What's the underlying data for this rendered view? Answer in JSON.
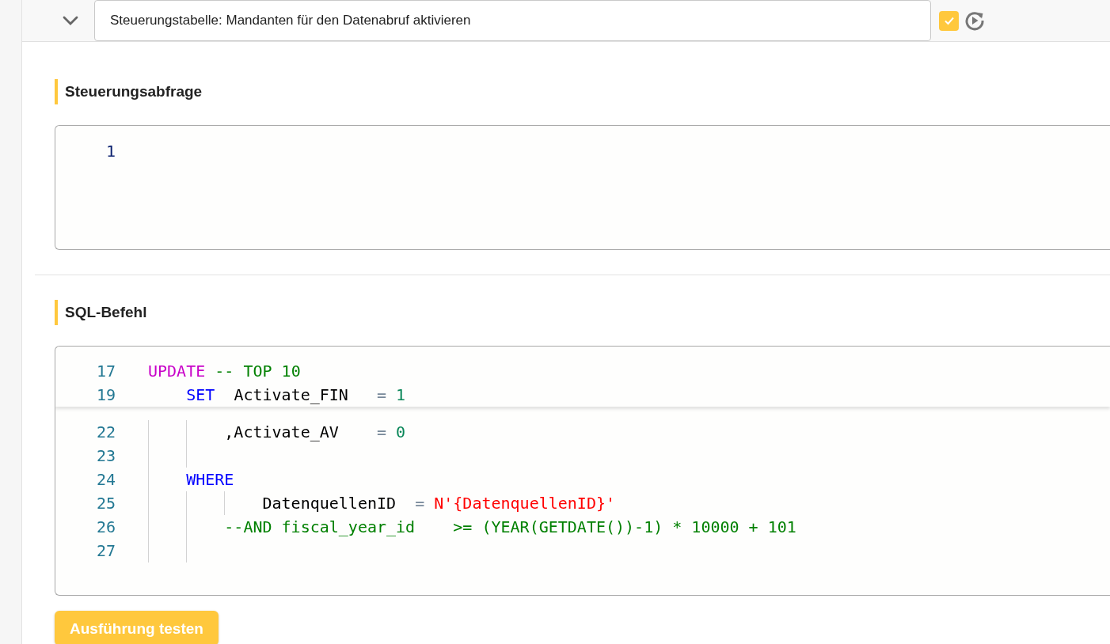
{
  "header": {
    "expanded": true,
    "title_value": "Steuerungstabelle: Mandanten für den Datenabruf aktivieren",
    "checked": true
  },
  "sections": [
    {
      "title": "Steuerungsabfrage",
      "editor": {
        "lines": [
          {
            "number": "1",
            "active": true
          }
        ]
      }
    },
    {
      "title": "SQL-Befehl",
      "editor": {
        "sticky_lines": [
          {
            "number": "17",
            "active": false,
            "tokens": [
              {
                "kind": "dml",
                "text": "UPDATE "
              },
              {
                "kind": "comment",
                "text": "-- TOP 10"
              }
            ]
          },
          {
            "number": "19",
            "active": false,
            "tokens": [
              {
                "kind": "keyword",
                "text": "    SET"
              },
              {
                "kind": "plain",
                "text": "  Activate_FIN   "
              },
              {
                "kind": "operator",
                "text": "= "
              },
              {
                "kind": "number",
                "text": "1"
              }
            ]
          }
        ],
        "lines": [
          {
            "number": "22",
            "active": false,
            "tokens": [
              {
                "kind": "plain",
                "text": "        ,Activate_AV    "
              },
              {
                "kind": "operator",
                "text": "= "
              },
              {
                "kind": "number",
                "text": "0"
              }
            ]
          },
          {
            "number": "23",
            "active": false
          },
          {
            "number": "24",
            "active": false,
            "tokens": [
              {
                "kind": "keyword",
                "text": "    WHERE"
              }
            ]
          },
          {
            "number": "25",
            "active": false,
            "tokens": [
              {
                "kind": "plain",
                "text": "            DatenquellenID  "
              },
              {
                "kind": "operator",
                "text": "= "
              },
              {
                "kind": "string",
                "text": "N'{DatenquellenID}'"
              }
            ]
          },
          {
            "number": "26",
            "active": false,
            "tokens": [
              {
                "kind": "comment",
                "text": "        --AND fiscal_year_id    >= (YEAR(GETDATE())-1) * 10000 + 101"
              }
            ]
          },
          {
            "number": "27",
            "active": false
          }
        ]
      }
    }
  ],
  "button": {
    "label": "Ausführung testen"
  }
}
